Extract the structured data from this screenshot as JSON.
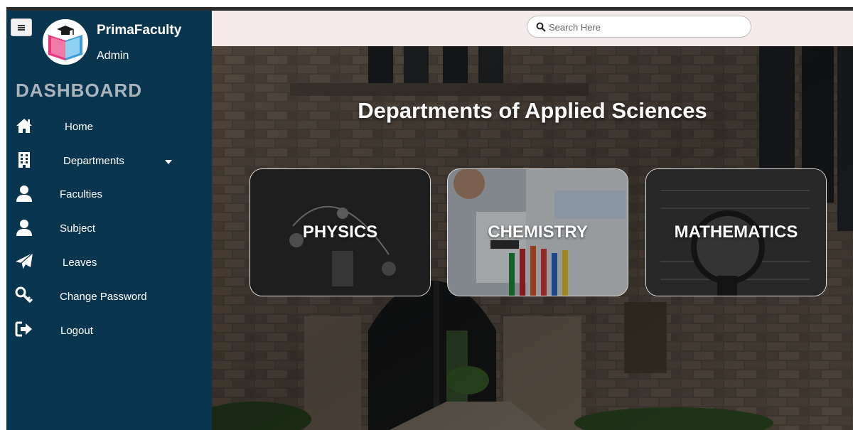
{
  "app": {
    "name": "PrimaFaculty",
    "role": "Admin",
    "dashboard_title": "DASHBOARD"
  },
  "sidebar": {
    "items": [
      {
        "label": "Home",
        "icon": "home-icon"
      },
      {
        "label": "Departments",
        "icon": "building-icon"
      },
      {
        "label": "Faculties",
        "icon": "user-icon"
      },
      {
        "label": "Subject",
        "icon": "user-icon"
      },
      {
        "label": "Leaves",
        "icon": "paper-plane-icon"
      },
      {
        "label": "Change Password",
        "icon": "key-icon"
      },
      {
        "label": "Logout",
        "icon": "sign-out-icon"
      }
    ]
  },
  "search": {
    "placeholder": "Search Here",
    "value": ""
  },
  "main": {
    "title": "Departments of Applied Sciences",
    "cards": [
      {
        "label": "PHYSICS"
      },
      {
        "label": "CHEMISTRY"
      },
      {
        "label": "MATHEMATICS"
      }
    ]
  },
  "colors": {
    "sidebar_bg": "#0a354f",
    "header_bg": "#f5eaea",
    "dashboard_title": "#aab4bd"
  }
}
